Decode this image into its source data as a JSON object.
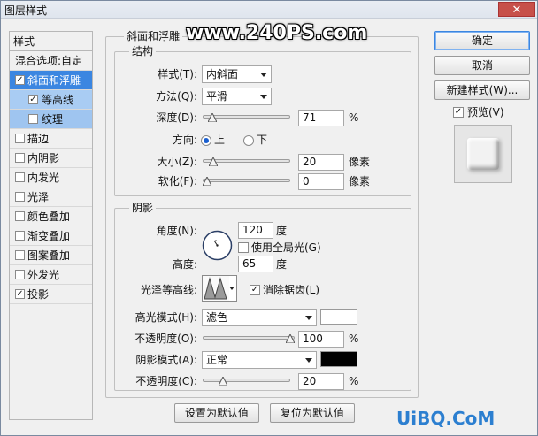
{
  "window": {
    "title": "图层样式",
    "close_glyph": "✕"
  },
  "watermark_top": "www.240PS.com",
  "watermark_bottom": "UiBQ.CoM",
  "sidebar": {
    "header": "样式",
    "blend_options": "混合选项:自定",
    "items": [
      {
        "label": "斜面和浮雕",
        "checked": true,
        "state": "selected"
      },
      {
        "label": "等高线",
        "checked": true,
        "state": "sub"
      },
      {
        "label": "纹理",
        "checked": false,
        "state": "sub"
      },
      {
        "label": "描边",
        "checked": false
      },
      {
        "label": "内阴影",
        "checked": false
      },
      {
        "label": "内发光",
        "checked": false
      },
      {
        "label": "光泽",
        "checked": false
      },
      {
        "label": "颜色叠加",
        "checked": false
      },
      {
        "label": "渐变叠加",
        "checked": false
      },
      {
        "label": "图案叠加",
        "checked": false
      },
      {
        "label": "外发光",
        "checked": false
      },
      {
        "label": "投影",
        "checked": true
      }
    ]
  },
  "bevel": {
    "group_title": "斜面和浮雕",
    "structure_title": "结构",
    "style_label": "样式(T):",
    "style_value": "内斜面",
    "technique_label": "方法(Q):",
    "technique_value": "平滑",
    "depth_label": "深度(D):",
    "depth_value": "71",
    "depth_unit": "%",
    "depth_fraction": 0.07,
    "direction_label": "方向:",
    "direction_up": "上",
    "direction_down": "下",
    "direction_selected": "上",
    "size_label": "大小(Z):",
    "size_value": "20",
    "size_unit": "像素",
    "size_fraction": 0.08,
    "soften_label": "软化(F):",
    "soften_value": "0",
    "soften_unit": "像素",
    "soften_fraction": 0.0
  },
  "shading": {
    "title": "阴影",
    "angle_label": "角度(N):",
    "angle_value": "120",
    "angle_unit": "度",
    "global_light_label": "使用全局光(G)",
    "global_light_checked": false,
    "altitude_label": "高度:",
    "altitude_value": "65",
    "altitude_unit": "度",
    "gloss_label": "光泽等高线:",
    "antialias_label": "消除锯齿(L)",
    "antialias_checked": true,
    "highlight_mode_label": "高光模式(H):",
    "highlight_mode_value": "滤色",
    "highlight_color": "#ffffff",
    "highlight_opacity_label": "不透明度(O):",
    "highlight_opacity_value": "100",
    "highlight_opacity_unit": "%",
    "highlight_opacity_fraction": 1.0,
    "shadow_mode_label": "阴影模式(A):",
    "shadow_mode_value": "正常",
    "shadow_color": "#000000",
    "shadow_opacity_label": "不透明度(C):",
    "shadow_opacity_value": "20",
    "shadow_opacity_unit": "%",
    "shadow_opacity_fraction": 0.2
  },
  "footer": {
    "set_default": "设置为默认值",
    "reset_default": "复位为默认值"
  },
  "right": {
    "ok": "确定",
    "cancel": "取消",
    "new_style": "新建样式(W)...",
    "preview_label": "预览(V)",
    "preview_checked": true
  },
  "colors": {
    "accent": "#3b86e1",
    "sub_selected": "#a9ccf3"
  }
}
